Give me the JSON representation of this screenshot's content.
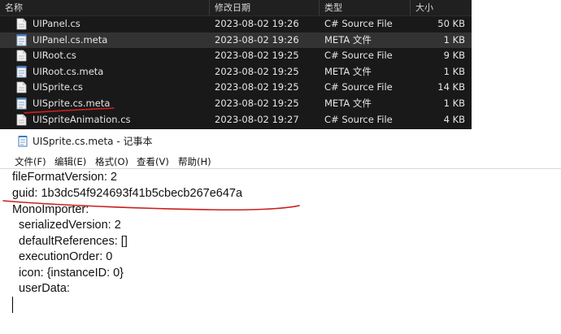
{
  "explorer": {
    "columns": {
      "name": "名称",
      "date": "修改日期",
      "type": "类型",
      "size": "大小"
    },
    "files": [
      {
        "name": "UIPanel.cs",
        "date": "2023-08-02 19:26",
        "type": "C# Source File",
        "size": "50 KB",
        "icon": "cs-file-icon"
      },
      {
        "name": "UIPanel.cs.meta",
        "date": "2023-08-02 19:26",
        "type": "META 文件",
        "size": "1 KB",
        "icon": "meta-file-icon"
      },
      {
        "name": "UIRoot.cs",
        "date": "2023-08-02 19:25",
        "type": "C# Source File",
        "size": "9 KB",
        "icon": "cs-file-icon"
      },
      {
        "name": "UIRoot.cs.meta",
        "date": "2023-08-02 19:25",
        "type": "META 文件",
        "size": "1 KB",
        "icon": "meta-file-icon"
      },
      {
        "name": "UISprite.cs",
        "date": "2023-08-02 19:25",
        "type": "C# Source File",
        "size": "14 KB",
        "icon": "cs-file-icon"
      },
      {
        "name": "UISprite.cs.meta",
        "date": "2023-08-02 19:25",
        "type": "META 文件",
        "size": "1 KB",
        "icon": "meta-file-icon"
      },
      {
        "name": "UISpriteAnimation.cs",
        "date": "2023-08-02 19:27",
        "type": "C# Source File",
        "size": "4 KB",
        "icon": "cs-file-icon"
      }
    ],
    "selected_index": 1
  },
  "notepad": {
    "title": "UISprite.cs.meta - 记事本",
    "menu": [
      "文件(F)",
      "编辑(E)",
      "格式(O)",
      "查看(V)",
      "帮助(H)"
    ],
    "lines": [
      "fileFormatVersion: 2",
      "guid: 1b3dc54f924693f41b5cbecb267e647a",
      "MonoImporter:",
      "  serializedVersion: 2",
      "  defaultReferences: []",
      "  executionOrder: 0",
      "  icon: {instanceID: 0}",
      "  userData:"
    ]
  },
  "annotation_color": "#cc1f1f",
  "colors": {
    "explorer_bg": "#191919",
    "selected_row": "#333333"
  }
}
